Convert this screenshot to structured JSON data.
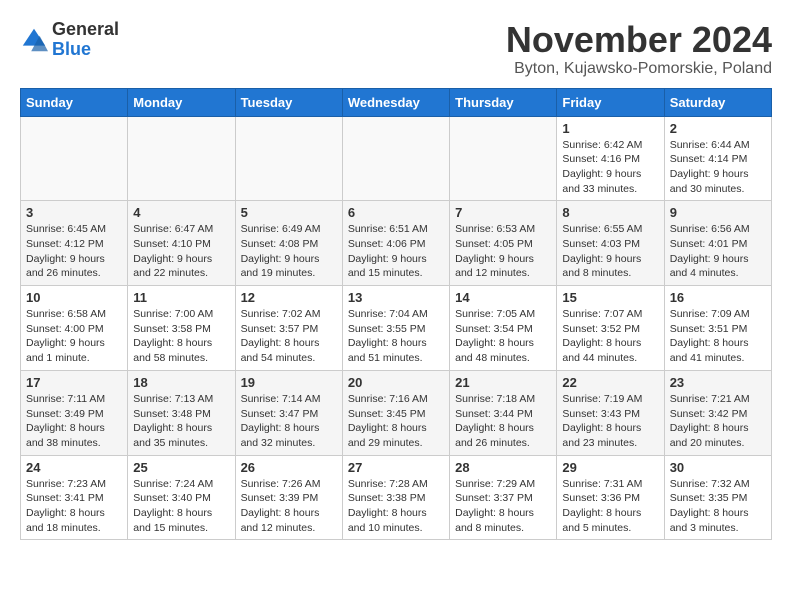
{
  "header": {
    "logo_general": "General",
    "logo_blue": "Blue",
    "month_title": "November 2024",
    "location": "Byton, Kujawsko-Pomorskie, Poland"
  },
  "days_of_week": [
    "Sunday",
    "Monday",
    "Tuesday",
    "Wednesday",
    "Thursday",
    "Friday",
    "Saturday"
  ],
  "weeks": [
    [
      {
        "day": "",
        "info": ""
      },
      {
        "day": "",
        "info": ""
      },
      {
        "day": "",
        "info": ""
      },
      {
        "day": "",
        "info": ""
      },
      {
        "day": "",
        "info": ""
      },
      {
        "day": "1",
        "info": "Sunrise: 6:42 AM\nSunset: 4:16 PM\nDaylight: 9 hours and 33 minutes."
      },
      {
        "day": "2",
        "info": "Sunrise: 6:44 AM\nSunset: 4:14 PM\nDaylight: 9 hours and 30 minutes."
      }
    ],
    [
      {
        "day": "3",
        "info": "Sunrise: 6:45 AM\nSunset: 4:12 PM\nDaylight: 9 hours and 26 minutes."
      },
      {
        "day": "4",
        "info": "Sunrise: 6:47 AM\nSunset: 4:10 PM\nDaylight: 9 hours and 22 minutes."
      },
      {
        "day": "5",
        "info": "Sunrise: 6:49 AM\nSunset: 4:08 PM\nDaylight: 9 hours and 19 minutes."
      },
      {
        "day": "6",
        "info": "Sunrise: 6:51 AM\nSunset: 4:06 PM\nDaylight: 9 hours and 15 minutes."
      },
      {
        "day": "7",
        "info": "Sunrise: 6:53 AM\nSunset: 4:05 PM\nDaylight: 9 hours and 12 minutes."
      },
      {
        "day": "8",
        "info": "Sunrise: 6:55 AM\nSunset: 4:03 PM\nDaylight: 9 hours and 8 minutes."
      },
      {
        "day": "9",
        "info": "Sunrise: 6:56 AM\nSunset: 4:01 PM\nDaylight: 9 hours and 4 minutes."
      }
    ],
    [
      {
        "day": "10",
        "info": "Sunrise: 6:58 AM\nSunset: 4:00 PM\nDaylight: 9 hours and 1 minute."
      },
      {
        "day": "11",
        "info": "Sunrise: 7:00 AM\nSunset: 3:58 PM\nDaylight: 8 hours and 58 minutes."
      },
      {
        "day": "12",
        "info": "Sunrise: 7:02 AM\nSunset: 3:57 PM\nDaylight: 8 hours and 54 minutes."
      },
      {
        "day": "13",
        "info": "Sunrise: 7:04 AM\nSunset: 3:55 PM\nDaylight: 8 hours and 51 minutes."
      },
      {
        "day": "14",
        "info": "Sunrise: 7:05 AM\nSunset: 3:54 PM\nDaylight: 8 hours and 48 minutes."
      },
      {
        "day": "15",
        "info": "Sunrise: 7:07 AM\nSunset: 3:52 PM\nDaylight: 8 hours and 44 minutes."
      },
      {
        "day": "16",
        "info": "Sunrise: 7:09 AM\nSunset: 3:51 PM\nDaylight: 8 hours and 41 minutes."
      }
    ],
    [
      {
        "day": "17",
        "info": "Sunrise: 7:11 AM\nSunset: 3:49 PM\nDaylight: 8 hours and 38 minutes."
      },
      {
        "day": "18",
        "info": "Sunrise: 7:13 AM\nSunset: 3:48 PM\nDaylight: 8 hours and 35 minutes."
      },
      {
        "day": "19",
        "info": "Sunrise: 7:14 AM\nSunset: 3:47 PM\nDaylight: 8 hours and 32 minutes."
      },
      {
        "day": "20",
        "info": "Sunrise: 7:16 AM\nSunset: 3:45 PM\nDaylight: 8 hours and 29 minutes."
      },
      {
        "day": "21",
        "info": "Sunrise: 7:18 AM\nSunset: 3:44 PM\nDaylight: 8 hours and 26 minutes."
      },
      {
        "day": "22",
        "info": "Sunrise: 7:19 AM\nSunset: 3:43 PM\nDaylight: 8 hours and 23 minutes."
      },
      {
        "day": "23",
        "info": "Sunrise: 7:21 AM\nSunset: 3:42 PM\nDaylight: 8 hours and 20 minutes."
      }
    ],
    [
      {
        "day": "24",
        "info": "Sunrise: 7:23 AM\nSunset: 3:41 PM\nDaylight: 8 hours and 18 minutes."
      },
      {
        "day": "25",
        "info": "Sunrise: 7:24 AM\nSunset: 3:40 PM\nDaylight: 8 hours and 15 minutes."
      },
      {
        "day": "26",
        "info": "Sunrise: 7:26 AM\nSunset: 3:39 PM\nDaylight: 8 hours and 12 minutes."
      },
      {
        "day": "27",
        "info": "Sunrise: 7:28 AM\nSunset: 3:38 PM\nDaylight: 8 hours and 10 minutes."
      },
      {
        "day": "28",
        "info": "Sunrise: 7:29 AM\nSunset: 3:37 PM\nDaylight: 8 hours and 8 minutes."
      },
      {
        "day": "29",
        "info": "Sunrise: 7:31 AM\nSunset: 3:36 PM\nDaylight: 8 hours and 5 minutes."
      },
      {
        "day": "30",
        "info": "Sunrise: 7:32 AM\nSunset: 3:35 PM\nDaylight: 8 hours and 3 minutes."
      }
    ]
  ]
}
